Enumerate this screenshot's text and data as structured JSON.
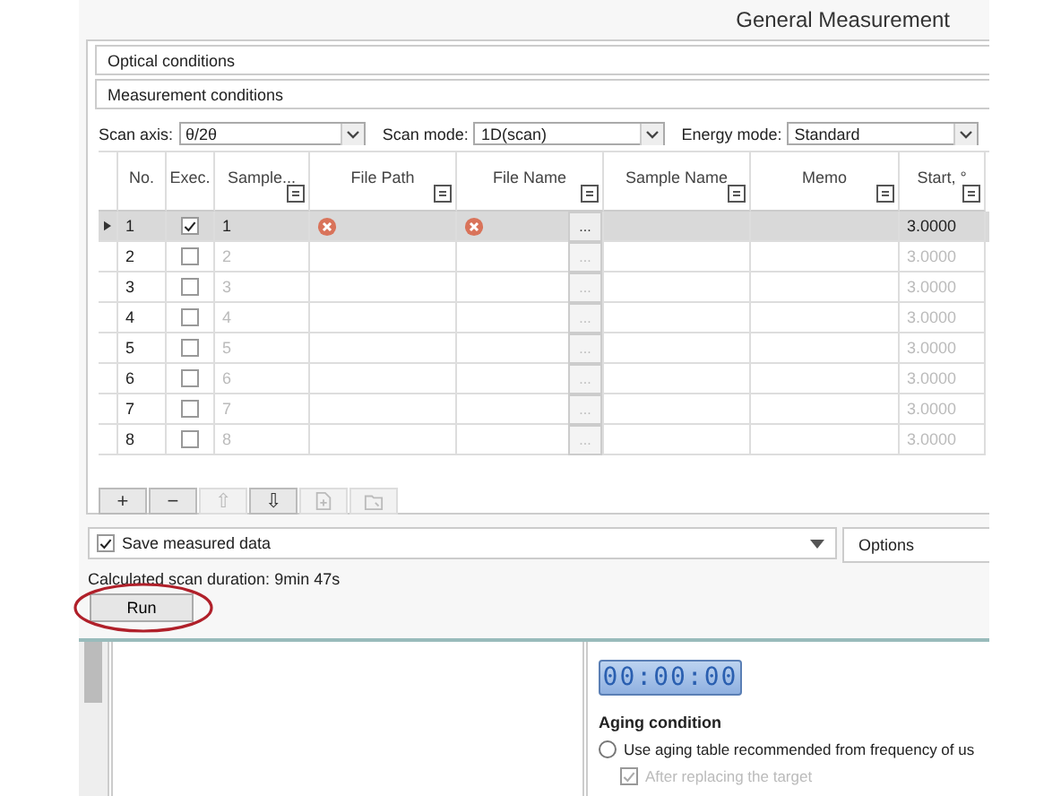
{
  "window": {
    "title": "General Measurement"
  },
  "sections": [
    {
      "label": "Optical conditions"
    },
    {
      "label": "Measurement conditions"
    }
  ],
  "combos": [
    {
      "label": "Scan axis:",
      "value": "θ/2θ"
    },
    {
      "label": "Scan mode:",
      "value": "1D(scan)"
    },
    {
      "label": "Energy mode:",
      "value": "Standard"
    }
  ],
  "table": {
    "columns": [
      {
        "label": "No.",
        "filter": false
      },
      {
        "label": "Exec.",
        "filter": false
      },
      {
        "label": "Sample...",
        "filter": true
      },
      {
        "label": "File Path",
        "filter": true
      },
      {
        "label": "File Name",
        "filter": true
      },
      {
        "label": "Sample Name",
        "filter": true
      },
      {
        "label": "Memo",
        "filter": true
      },
      {
        "label": "Start, °",
        "filter": true
      }
    ],
    "rows": [
      {
        "no": "1",
        "exec": true,
        "sample": "1",
        "path_error": true,
        "name_error": true,
        "browse": "...",
        "start": "3.0000",
        "selected": true
      },
      {
        "no": "2",
        "exec": false,
        "sample": "2",
        "path_error": false,
        "name_error": false,
        "browse": "...",
        "start": "3.0000",
        "selected": false
      },
      {
        "no": "3",
        "exec": false,
        "sample": "3",
        "path_error": false,
        "name_error": false,
        "browse": "...",
        "start": "3.0000",
        "selected": false
      },
      {
        "no": "4",
        "exec": false,
        "sample": "4",
        "path_error": false,
        "name_error": false,
        "browse": "...",
        "start": "3.0000",
        "selected": false
      },
      {
        "no": "5",
        "exec": false,
        "sample": "5",
        "path_error": false,
        "name_error": false,
        "browse": "...",
        "start": "3.0000",
        "selected": false
      },
      {
        "no": "6",
        "exec": false,
        "sample": "6",
        "path_error": false,
        "name_error": false,
        "browse": "...",
        "start": "3.0000",
        "selected": false
      },
      {
        "no": "7",
        "exec": false,
        "sample": "7",
        "path_error": false,
        "name_error": false,
        "browse": "...",
        "start": "3.0000",
        "selected": false
      },
      {
        "no": "8",
        "exec": false,
        "sample": "8",
        "path_error": false,
        "name_error": false,
        "browse": "...",
        "start": "3.0000",
        "selected": false
      }
    ]
  },
  "toolbar": [
    {
      "kind": "text",
      "label": "+",
      "disabled": false
    },
    {
      "kind": "text",
      "label": "−",
      "disabled": false
    },
    {
      "kind": "text",
      "label": "⇧",
      "disabled": true
    },
    {
      "kind": "text",
      "label": "⇩",
      "disabled": false
    },
    {
      "kind": "import",
      "disabled": true
    },
    {
      "kind": "export",
      "disabled": true
    }
  ],
  "save": {
    "label": "Save measured data",
    "checked": true
  },
  "options": {
    "label": "Options"
  },
  "duration": "Calculated scan duration: 9min 47s",
  "run": {
    "label": "Run",
    "highlighted": true
  },
  "lower": {
    "timer": "00:00:00",
    "aging_title": "Aging condition",
    "radio": {
      "label": "Use aging table recommended from frequency of us",
      "selected": false
    },
    "check": {
      "label": "After replacing the target",
      "checked": true,
      "disabled": true
    }
  }
}
